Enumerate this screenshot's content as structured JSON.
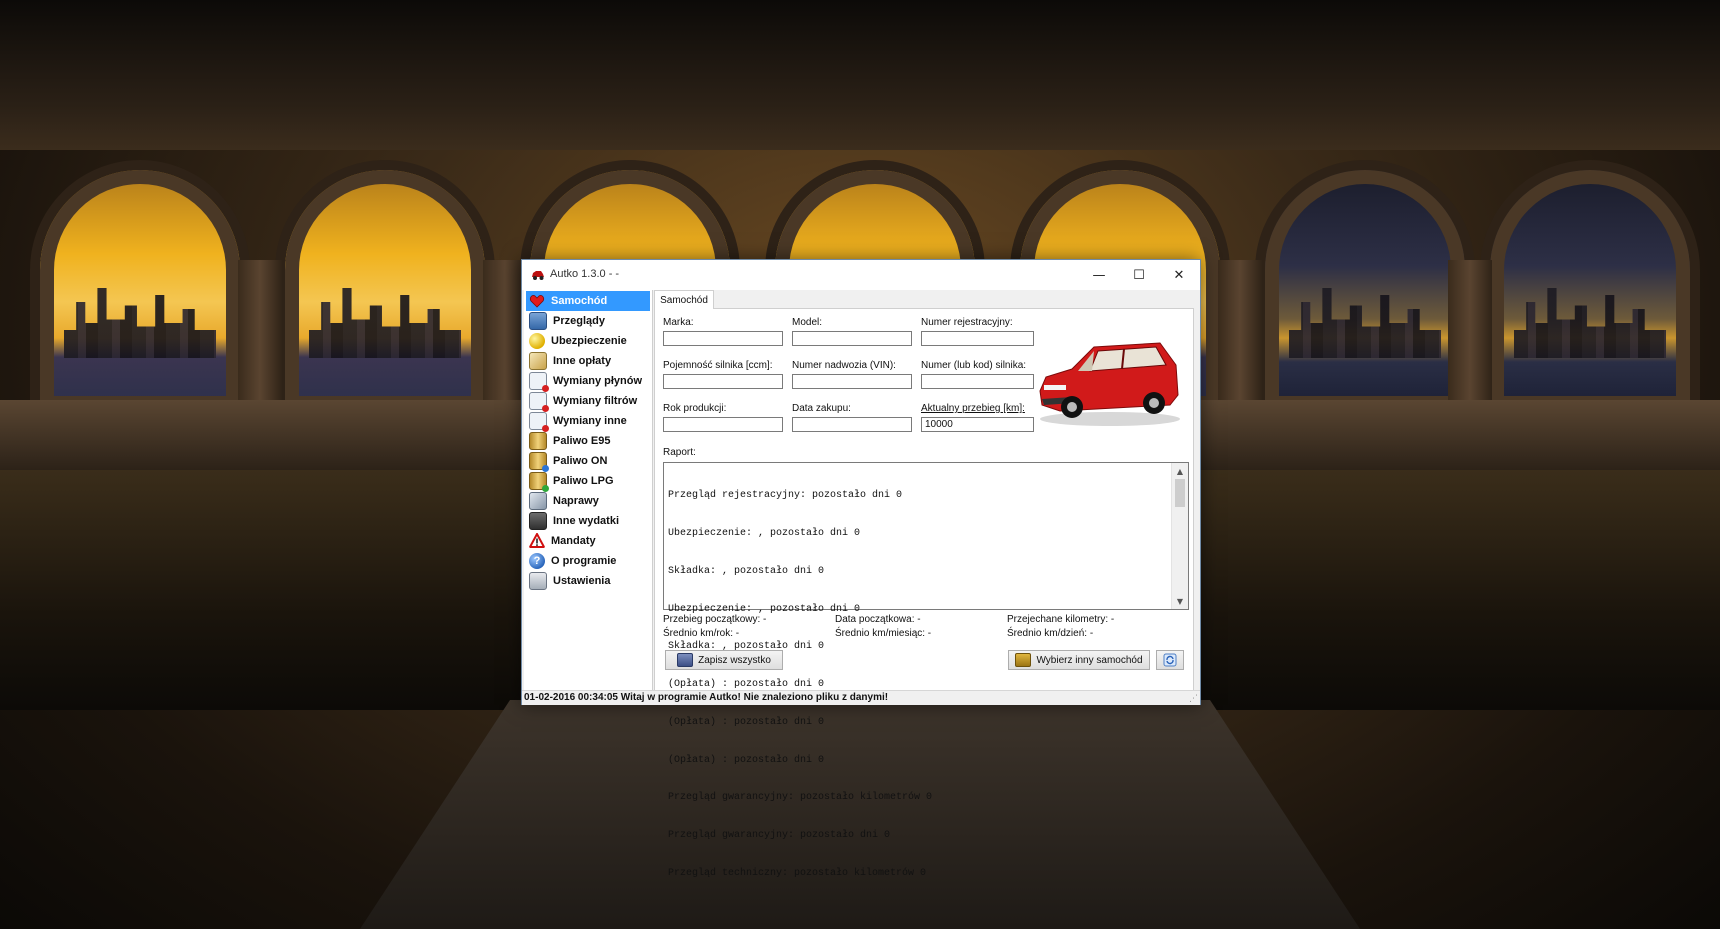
{
  "window": {
    "title": "Autko 1.3.0 -  -",
    "minimize_glyph": "—",
    "maximize_glyph": "☐",
    "close_glyph": "✕"
  },
  "sidebar": {
    "items": [
      {
        "label": "Samochód",
        "icon": "heart-icon",
        "selected": true
      },
      {
        "label": "Przeglądy",
        "icon": "chart-icon"
      },
      {
        "label": "Ubezpieczenie",
        "icon": "ball-icon"
      },
      {
        "label": "Inne opłaty",
        "icon": "pencil-icon"
      },
      {
        "label": "Wymiany płynów",
        "icon": "calendar-icon"
      },
      {
        "label": "Wymiany filtrów",
        "icon": "calendar-icon"
      },
      {
        "label": "Wymiany inne",
        "icon": "calendar-icon"
      },
      {
        "label": "Paliwo E95",
        "icon": "fuel-can-icon"
      },
      {
        "label": "Paliwo ON",
        "icon": "fuel-can-icon"
      },
      {
        "label": "Paliwo LPG",
        "icon": "fuel-can-icon"
      },
      {
        "label": "Naprawy",
        "icon": "tools-icon"
      },
      {
        "label": "Inne wydatki",
        "icon": "calculator-icon"
      },
      {
        "label": "Mandaty",
        "icon": "warning-icon"
      },
      {
        "label": "O programie",
        "icon": "help-icon"
      },
      {
        "label": "Ustawienia",
        "icon": "settings-icon"
      }
    ]
  },
  "tab": {
    "label": "Samochód"
  },
  "form": {
    "marka_label": "Marka:",
    "model_label": "Model:",
    "numer_rej_label": "Numer rejestracyjny:",
    "pojemnosc_label": "Pojemność silnika [ccm]:",
    "vin_label": "Numer nadwozia (VIN):",
    "silnik_label": "Numer (lub kod) silnika:",
    "rok_label": "Rok produkcji:",
    "data_zakupu_label": "Data zakupu:",
    "przebieg_label": "Aktualny przebieg [km]:",
    "marka_value": "",
    "model_value": "",
    "numer_rej_value": "",
    "pojemnosc_value": "",
    "vin_value": "",
    "silnik_value": "",
    "rok_value": "",
    "data_zakupu_value": "",
    "przebieg_value": "10000"
  },
  "report": {
    "label": "Raport:",
    "lines": [
      "Przegląd rejestracyjny: pozostało dni 0",
      "Ubezpieczenie: , pozostało dni 0",
      "Składka: , pozostało dni 0",
      "Ubezpieczenie: , pozostało dni 0",
      "Składka: , pozostało dni 0",
      "(Opłata) : pozostało dni 0",
      "(Opłata) : pozostało dni 0",
      "(Opłata) : pozostało dni 0",
      "Przegląd gwarancyjny: pozostało kilometrów 0",
      "Przegląd gwarancyjny: pozostało dni 0",
      "Przegląd techniczny: pozostało kilometrów 0"
    ]
  },
  "stats": {
    "przebieg_poczatkowy": "Przebieg początkowy: -",
    "data_poczatkowa": "Data początkowa: -",
    "przejechane_km": "Przejechane kilometry: -",
    "srednio_rok": "Średnio km/rok: -",
    "srednio_miesiac": "Średnio km/miesiąc: -",
    "srednio_dzien": "Średnio km/dzień: -"
  },
  "buttons": {
    "save_all": "Zapisz wszystko",
    "choose_car": "Wybierz inny samochód"
  },
  "status": {
    "text": "01-02-2016 00:34:05 Witaj w programie Autko! Nie znaleziono pliku z danymi!"
  }
}
